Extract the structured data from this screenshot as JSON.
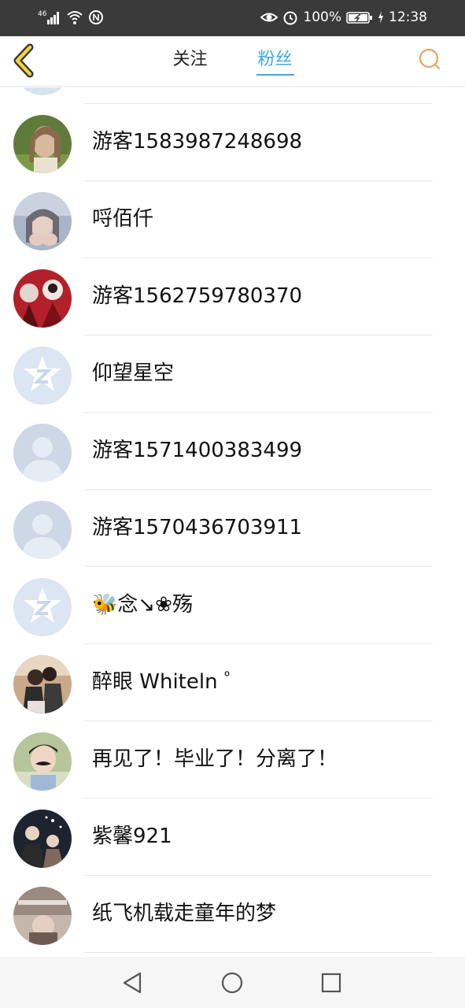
{
  "status_bar": {
    "signal": "46",
    "battery_percent": "100%",
    "time": "12:38",
    "icons": [
      "signal-icon",
      "wifi-icon",
      "nfc-icon",
      "eye-icon",
      "alarm-icon",
      "battery-icon",
      "charging-icon"
    ]
  },
  "header": {
    "tabs": [
      {
        "label": "关注",
        "active": false
      },
      {
        "label": "粉丝",
        "active": true
      }
    ],
    "accent_color": "#3fa9d9",
    "back_icon": "chevron-left-icon",
    "search_icon": "search-icon"
  },
  "followers": [
    {
      "name": "游客1583987248698",
      "avatar": "photo-girl-grass"
    },
    {
      "name": "哷佰仟",
      "avatar": "photo-girl-hands"
    },
    {
      "name": "游客1562759780370",
      "avatar": "photo-red-portrait"
    },
    {
      "name": "仰望星空",
      "avatar": "default-qq-avatar"
    },
    {
      "name": "游客1571400383499",
      "avatar": "default-person-avatar"
    },
    {
      "name": "游客1570436703911",
      "avatar": "default-person-avatar"
    },
    {
      "name": "🐝念↘❀殇",
      "avatar": "default-qq-avatar"
    },
    {
      "name": "醉眼 Whiteln ゜",
      "avatar": "photo-couple"
    },
    {
      "name": "再见了！毕业了！分离了！",
      "avatar": "photo-boy-mustache"
    },
    {
      "name": "紫馨921",
      "avatar": "photo-group-night"
    },
    {
      "name": "纸飞机载走童年的梦",
      "avatar": "photo-tfboys"
    }
  ],
  "nav_bar": {
    "icons": [
      "back-triangle-icon",
      "home-circle-icon",
      "recents-square-icon"
    ]
  }
}
